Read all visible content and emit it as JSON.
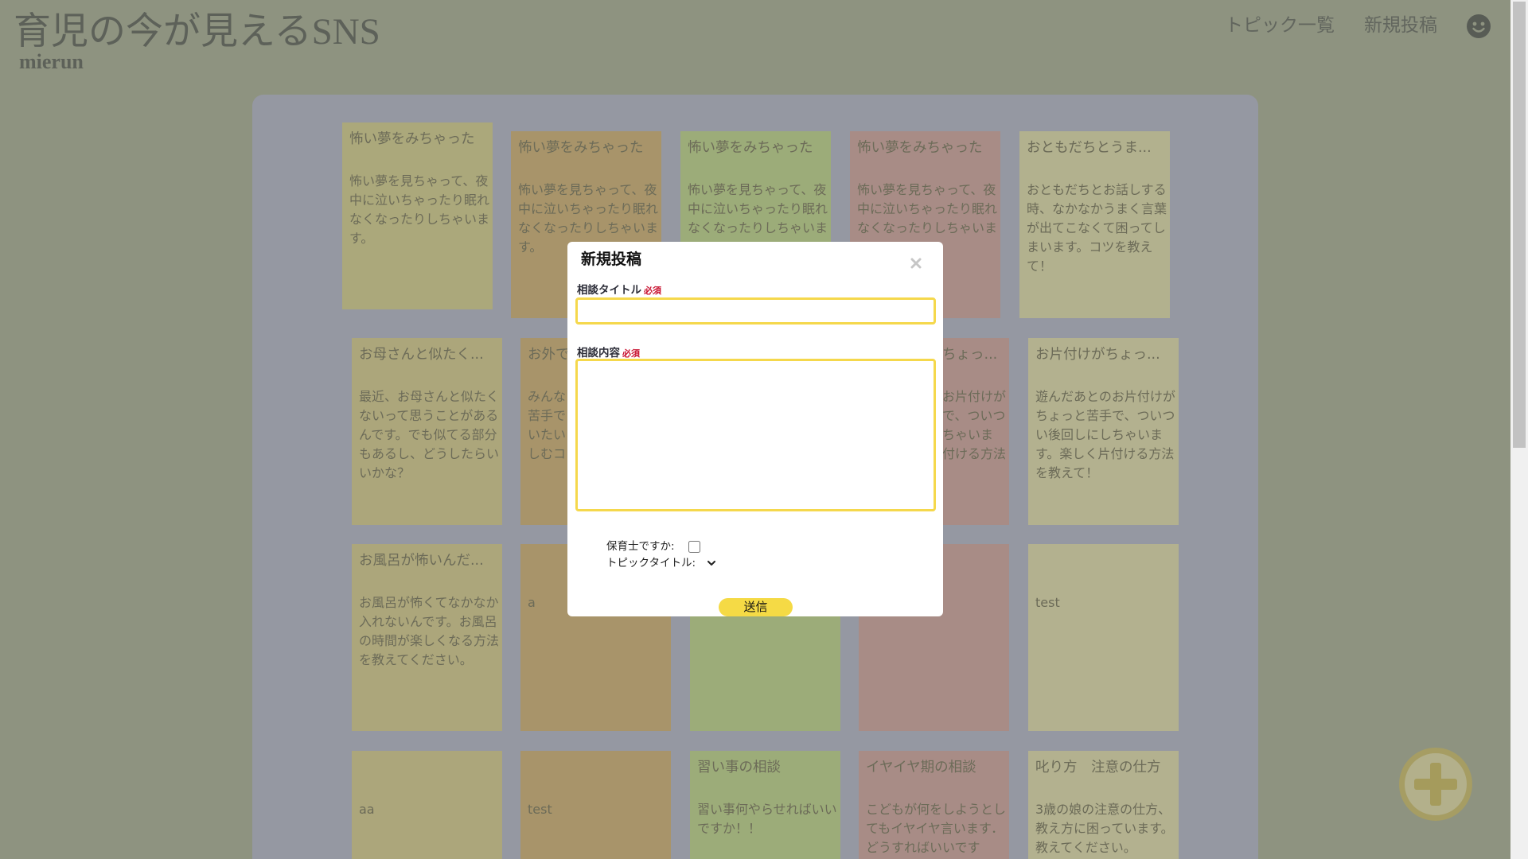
{
  "header": {
    "title": "育児の今が見えるSNS",
    "subtitle": "mierun",
    "nav": [
      {
        "label": "トピック一覧"
      },
      {
        "label": "新規投稿"
      }
    ],
    "account_icon": "account-face-icon"
  },
  "cards": [
    {
      "title": "怖い夢をみちゃった",
      "body": "怖い夢を見ちゃって、夜中に泣いちゃったり眠れなくなったりしちゃいます。",
      "color": "#aba87b"
    },
    {
      "title": "怖い夢をみちゃった",
      "body": "怖い夢を見ちゃって、夜中に泣いちゃったり眠れなくなったりしちゃいます。",
      "color": "#a8946a"
    },
    {
      "title": "怖い夢をみちゃった",
      "body": "怖い夢を見ちゃって、夜中に泣いちゃったり眠れなくなったりしちゃいま",
      "color": "#9cac79"
    },
    {
      "title": "怖い夢をみちゃった",
      "body": "怖い夢を見ちゃって、夜中に泣いちゃったり眠れなくなったりしちゃいま",
      "color": "#a88c86"
    },
    {
      "title": "おともだちとうま...",
      "body": "おともだちとお話しする時、なかなかうまく言葉が出てこなくて困ってしまいます。コツを教えて！",
      "color": "#b2b18e"
    },
    {
      "title": "お母さんと似たく...",
      "body": "最近、お母さんと似たくないって思うことがあるんです。でも似てる部分もあるし、どうしたらいいかな？",
      "color": "#aca67b"
    },
    {
      "title": "お外で",
      "body": "みんな\n苦手で\nいたい\nしむコ",
      "color": "#a8946a"
    },
    {
      "title": "",
      "body": "",
      "color": "#9cac79"
    },
    {
      "title": "ちょっ...",
      "body": "お片付けが\nで、ついつ\nちゃいま\n付ける方法",
      "color": "#a88c86"
    },
    {
      "title": "お片付けがちょっ...",
      "body": "遊んだあとのお片付けがちょっと苦手で、ついつい後回しにしちゃいます。楽しく片付ける方法を教えて！",
      "color": "#b3b18f"
    },
    {
      "title": "お風呂が怖いんだ...",
      "body": "お風呂が怖くてなかなか入れないんです。お風呂の時間が楽しくなる方法を教えてください。",
      "color": "#aca67b"
    },
    {
      "title": "",
      "body": "a",
      "color": "#a8946a"
    },
    {
      "title": "",
      "body": "",
      "color": "#9cac79"
    },
    {
      "title": "",
      "body": "",
      "color": "#a88c86"
    },
    {
      "title": "",
      "body": "test",
      "color": "#b3b18f"
    },
    {
      "title": "",
      "body": "aa",
      "color": "#aca67b"
    },
    {
      "title": "",
      "body": "test",
      "color": "#a8946a"
    },
    {
      "title": "習い事の相談",
      "body": "習い事何やらせればいいですか！！",
      "color": "#9cac79"
    },
    {
      "title": "イヤイヤ期の相談",
      "body": "こどもが何をしようとしてもイヤイヤ言います．どうすればいいです",
      "color": "#a88c86"
    },
    {
      "title": "叱り方　注意の仕方",
      "body": "3歳の娘の注意の仕方、教え方に困っています。教えてください。",
      "color": "#b3b18f"
    }
  ],
  "modal": {
    "title": "新規投稿",
    "close_icon": "close-icon",
    "fields": {
      "title_label": "相談タイトル",
      "title_required": "必須",
      "title_value": "",
      "content_label": "相談内容",
      "content_required": "必須",
      "content_value": "",
      "nursery_label": "保育士ですか:",
      "nursery_checked": false,
      "topic_label": "トピックタイトル:",
      "topic_selected": ""
    },
    "submit_label": "送信"
  },
  "fab": {
    "icon": "plus-icon"
  },
  "theme": {
    "page_bg": "#8e9380",
    "panel_bg": "#9598a2",
    "accent": "#f5d84c",
    "required": "#c8102e"
  }
}
